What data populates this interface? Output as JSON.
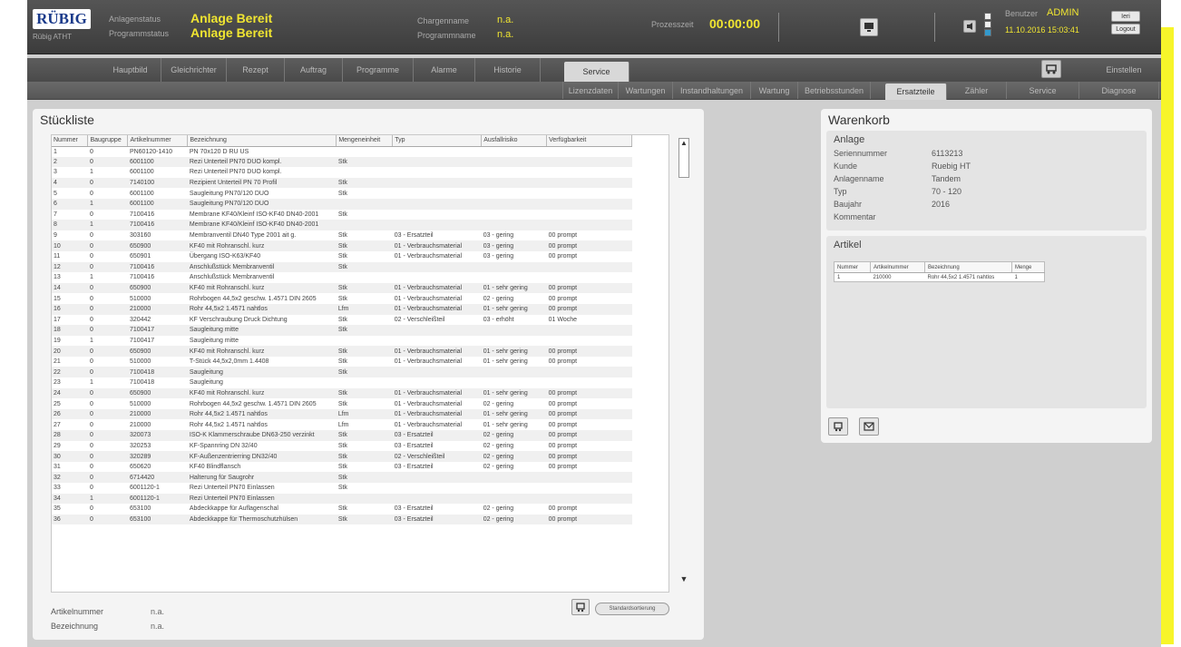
{
  "header": {
    "logo": "RÜBIG",
    "logo_sub": "Rübig ATHT",
    "anlagenstatus_label": "Anlagenstatus",
    "anlagenstatus_value": "Anlage Bereit",
    "programmstatus_label": "Programmstatus",
    "programmstatus_value": "Anlage Bereit",
    "chargenname_label": "Chargenname",
    "chargenname_value": "n.a.",
    "programmname_label": "Programmname",
    "programmname_value": "n.a.",
    "prozesszeit_label": "Prozesszeit",
    "prozesszeit_value": "00:00:00",
    "benutzer_label": "Benutzer",
    "benutzer_value": "ADMIN",
    "datetime": "11.10.2016 15:03:41",
    "btn_top": "Ieri",
    "btn_bottom": "Logout"
  },
  "nav": {
    "main_tabs": [
      "Hauptbild",
      "Gleichrichter",
      "Rezept",
      "Auftrag",
      "Programme",
      "Alarme",
      "Historie",
      "Service"
    ],
    "main_active": "Service",
    "right_btn": "Einstellen",
    "sub_tabs": [
      "Lizenzdaten",
      "Wartungen",
      "Instandhaltungen",
      "Wartung",
      "Betriebsstunden",
      "Ersatzteile",
      "Zähler",
      "Service",
      "Diagnose"
    ],
    "sub_active": "Ersatzteile"
  },
  "stueckliste": {
    "title": "Stückliste",
    "columns": [
      "Nummer",
      "Baugruppe",
      "Artikelnummer",
      "Bezeichnung",
      "Mengeneinheit",
      "Typ",
      "Ausfallrisiko",
      "Verfügbarkeit"
    ],
    "rows": [
      [
        "1",
        "0",
        "PN60120-1410",
        "PN 70x120 D RU US",
        "",
        "",
        "",
        ""
      ],
      [
        "2",
        "0",
        "6001100",
        "Rezi Unterteil PN70 DUO kompl.",
        "Stk",
        "",
        "",
        ""
      ],
      [
        "3",
        "1",
        "6001100",
        "Rezi Unterteil PN70 DUO kompl.",
        "",
        "",
        "",
        ""
      ],
      [
        "4",
        "0",
        "7140100",
        "Rezipient Unterteil PN 70 Profil",
        "Stk",
        "",
        "",
        ""
      ],
      [
        "5",
        "0",
        "6001100",
        "Saugleitung PN70/120 DUO",
        "Stk",
        "",
        "",
        ""
      ],
      [
        "6",
        "1",
        "6001100",
        "Saugleitung PN70/120 DUO",
        "",
        "",
        "",
        ""
      ],
      [
        "7",
        "0",
        "7100416",
        "Membrane KF40/Kleinf ISO-KF40 DN40-2001",
        "Stk",
        "",
        "",
        ""
      ],
      [
        "8",
        "1",
        "7100416",
        "Membrane KF40/Kleinf ISO-KF40 DN40-2001",
        "",
        "",
        "",
        ""
      ],
      [
        "9",
        "0",
        "303160",
        "Membranventil DN40 Type 2001 ait g.",
        "Stk",
        "03 - Ersatzteil",
        "03 - gering",
        "00 prompt"
      ],
      [
        "10",
        "0",
        "650900",
        "KF40 mit Rohranschl. kurz",
        "Stk",
        "01 - Verbrauchsmaterial",
        "03 - gering",
        "00 prompt"
      ],
      [
        "11",
        "0",
        "650901",
        "Übergang ISO-K63/KF40",
        "Stk",
        "01 - Verbrauchsmaterial",
        "03 - gering",
        "00 prompt"
      ],
      [
        "12",
        "0",
        "7100416",
        "Anschlußstück Membranventil",
        "Stk",
        "",
        "",
        ""
      ],
      [
        "13",
        "1",
        "7100416",
        "Anschlußstück Membranventil",
        "",
        "",
        "",
        ""
      ],
      [
        "14",
        "0",
        "650900",
        "KF40 mit Rohranschl. kurz",
        "Stk",
        "01 - Verbrauchsmaterial",
        "01 - sehr gering",
        "00 prompt"
      ],
      [
        "15",
        "0",
        "510000",
        "Rohrbogen 44,5x2 geschw. 1.4571 DIN 2605",
        "Stk",
        "01 - Verbrauchsmaterial",
        "02 - gering",
        "00 prompt"
      ],
      [
        "16",
        "0",
        "210000",
        "Rohr 44,5x2 1.4571 nahtlos",
        "Lfm",
        "01 - Verbrauchsmaterial",
        "01 - sehr gering",
        "00 prompt"
      ],
      [
        "17",
        "0",
        "320442",
        "KF Verschraubung Druck Dichtung",
        "Stk",
        "02 - Verschleißteil",
        "03 - erhöht",
        "01 Woche"
      ],
      [
        "18",
        "0",
        "7100417",
        "Saugleitung mitte",
        "Stk",
        "",
        "",
        ""
      ],
      [
        "19",
        "1",
        "7100417",
        "Saugleitung mitte",
        "",
        "",
        "",
        ""
      ],
      [
        "20",
        "0",
        "650900",
        "KF40 mit Rohranschl. kurz",
        "Stk",
        "01 - Verbrauchsmaterial",
        "01 - sehr gering",
        "00 prompt"
      ],
      [
        "21",
        "0",
        "510000",
        "T-Stück 44,5x2,0mm 1.4408",
        "Stk",
        "01 - Verbrauchsmaterial",
        "01 - sehr gering",
        "00 prompt"
      ],
      [
        "22",
        "0",
        "7100418",
        "Saugleitung",
        "Stk",
        "",
        "",
        ""
      ],
      [
        "23",
        "1",
        "7100418",
        "Saugleitung",
        "",
        "",
        "",
        ""
      ],
      [
        "24",
        "0",
        "650900",
        "KF40 mit Rohranschl. kurz",
        "Stk",
        "01 - Verbrauchsmaterial",
        "01 - sehr gering",
        "00 prompt"
      ],
      [
        "25",
        "0",
        "510000",
        "Rohrbogen 44,5x2 geschw. 1.4571 DIN 2605",
        "Stk",
        "01 - Verbrauchsmaterial",
        "02 - gering",
        "00 prompt"
      ],
      [
        "26",
        "0",
        "210000",
        "Rohr 44,5x2 1.4571 nahtlos",
        "Lfm",
        "01 - Verbrauchsmaterial",
        "01 - sehr gering",
        "00 prompt"
      ],
      [
        "27",
        "0",
        "210000",
        "Rohr 44,5x2 1.4571 nahtlos",
        "Lfm",
        "01 - Verbrauchsmaterial",
        "01 - sehr gering",
        "00 prompt"
      ],
      [
        "28",
        "0",
        "320073",
        "ISO-K Klammerschraube DN63-250 verzinkt",
        "Stk",
        "03 - Ersatzteil",
        "02 - gering",
        "00 prompt"
      ],
      [
        "29",
        "0",
        "320253",
        "KF-Spannring DN 32/40",
        "Stk",
        "03 - Ersatzteil",
        "02 - gering",
        "00 prompt"
      ],
      [
        "30",
        "0",
        "320289",
        "KF-Außenzentrierring DN32/40",
        "Stk",
        "02 - Verschleißteil",
        "02 - gering",
        "00 prompt"
      ],
      [
        "31",
        "0",
        "650620",
        "KF40 Blindflansch",
        "Stk",
        "03 - Ersatzteil",
        "02 - gering",
        "00 prompt"
      ],
      [
        "32",
        "0",
        "6714420",
        "Halterung für Saugrohr",
        "Stk",
        "",
        "",
        ""
      ],
      [
        "33",
        "0",
        "6001120-1",
        "Rezi Unterteil PN70 Einlassen",
        "Stk",
        "",
        "",
        ""
      ],
      [
        "34",
        "1",
        "6001120-1",
        "Rezi Unterteil PN70 Einlassen",
        "",
        "",
        "",
        ""
      ],
      [
        "35",
        "0",
        "653100",
        "Abdeckkappe für Auflagenschal",
        "Stk",
        "03 - Ersatzteil",
        "02 - gering",
        "00 prompt"
      ],
      [
        "36",
        "0",
        "653100",
        "Abdeckkappe für Thermoschutzhülsen",
        "Stk",
        "03 - Ersatzteil",
        "02 - gering",
        "00 prompt"
      ]
    ],
    "artikelnummer_label": "Artikelnummer",
    "artikelnummer_value": "n.a.",
    "bezeichnung_label": "Bezeichnung",
    "bezeichnung_value": "n.a.",
    "btn_details": "Standardsortierung"
  },
  "warenkorb": {
    "title": "Warenkorb",
    "anlage_title": "Anlage",
    "anlage": [
      {
        "k": "Seriennummer",
        "v": "6113213"
      },
      {
        "k": "Kunde",
        "v": "Ruebig HT"
      },
      {
        "k": "Anlagenname",
        "v": "Tandem"
      },
      {
        "k": "Typ",
        "v": "70 - 120"
      },
      {
        "k": "Baujahr",
        "v": "2016"
      },
      {
        "k": "Kommentar",
        "v": ""
      }
    ],
    "artikel_title": "Artikel",
    "artikel_columns": [
      "Nummer",
      "Artikelnummer",
      "Bezeichnung",
      "Menge"
    ],
    "artikel_rows": [
      [
        "1",
        "210000",
        "Rohr 44,5x2 1.4571 nahtlos",
        "1"
      ]
    ]
  },
  "colors": {
    "accent_yellow": "#f0e531",
    "header_bg": "#3c3c3c",
    "panel_bg": "#f4f4f4"
  }
}
